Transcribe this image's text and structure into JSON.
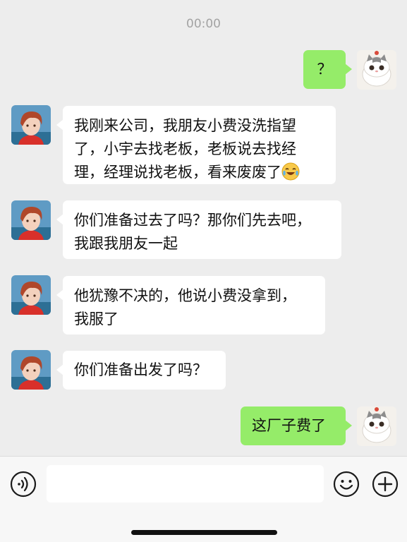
{
  "status_time": "00:00",
  "messages": [
    {
      "side": "right",
      "text": "？"
    },
    {
      "side": "left",
      "lines": [
        "我刚来公司，我朋友小费没洗指望",
        "了，小宇去找老板，老板说去找经",
        "理，经理说找老板，看来废废了"
      ],
      "emoji": "laugh-cry-emoji"
    },
    {
      "side": "left",
      "lines": [
        "你们准备过去了吗？那你们先去吧，",
        "我跟我朋友一起"
      ]
    },
    {
      "side": "left",
      "lines": [
        "他犹豫不决的，他说小费没拿到，",
        "我服了"
      ]
    },
    {
      "side": "left",
      "lines": [
        "你们准备出发了吗？"
      ]
    },
    {
      "side": "right",
      "text": "这厂子费了"
    }
  ],
  "input": {
    "value": "",
    "placeholder": ""
  },
  "icons": {
    "voice": "voice-icon",
    "emoji": "emoji-icon",
    "plus": "plus-icon"
  },
  "colors": {
    "background": "#ededed",
    "bubble_self": "#95ec69",
    "bubble_other": "#ffffff"
  }
}
